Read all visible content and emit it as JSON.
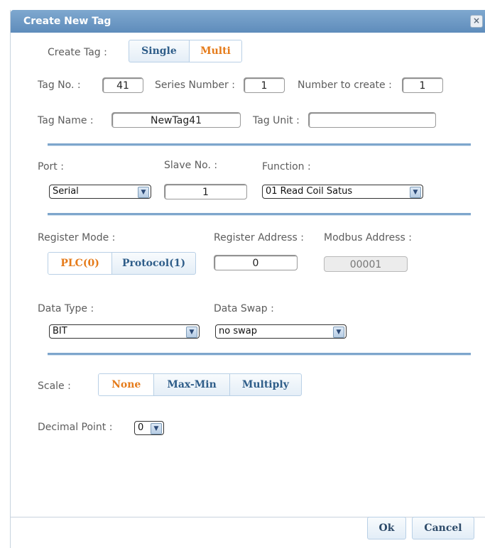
{
  "dialog": {
    "title": "Create New Tag",
    "close_glyph": "×"
  },
  "create_tag": {
    "label": "Create Tag :",
    "options": [
      "Single",
      "Multi"
    ],
    "selected": "Multi"
  },
  "tag_no": {
    "label": "Tag No. :",
    "value": "41"
  },
  "series_number": {
    "label": "Series Number :",
    "value": "1"
  },
  "number_to_create": {
    "label": "Number to create :",
    "value": "1"
  },
  "tag_name": {
    "label": "Tag Name :",
    "value": "NewTag41"
  },
  "tag_unit": {
    "label": "Tag Unit :",
    "value": ""
  },
  "port": {
    "label": "Port :",
    "value": "Serial"
  },
  "slave_no": {
    "label": "Slave No. :",
    "value": "1"
  },
  "function": {
    "label": "Function :",
    "value": "01 Read Coil Satus"
  },
  "register_mode": {
    "label": "Register Mode :",
    "options": [
      "PLC(0)",
      "Protocol(1)"
    ],
    "selected": "PLC(0)"
  },
  "register_address": {
    "label": "Register Address :",
    "value": "0"
  },
  "modbus_address": {
    "label": "Modbus Address :",
    "value": "00001"
  },
  "data_type": {
    "label": "Data Type :",
    "value": "BIT"
  },
  "data_swap": {
    "label": "Data Swap :",
    "value": "no swap"
  },
  "scale": {
    "label": "Scale :",
    "options": [
      "None",
      "Max-Min",
      "Multiply"
    ],
    "selected": "None"
  },
  "decimal_point": {
    "label": "Decimal Point :",
    "value": "0"
  },
  "footer": {
    "ok_label": "Ok",
    "cancel_label": "Cancel"
  },
  "icons": {
    "dropdown_arrow": "chevron-down-icon",
    "close": "close-icon"
  },
  "colors": {
    "accent_selected": "#e57b1a",
    "titlebar": "#6f9bc6",
    "divider": "#7ea6cc"
  }
}
